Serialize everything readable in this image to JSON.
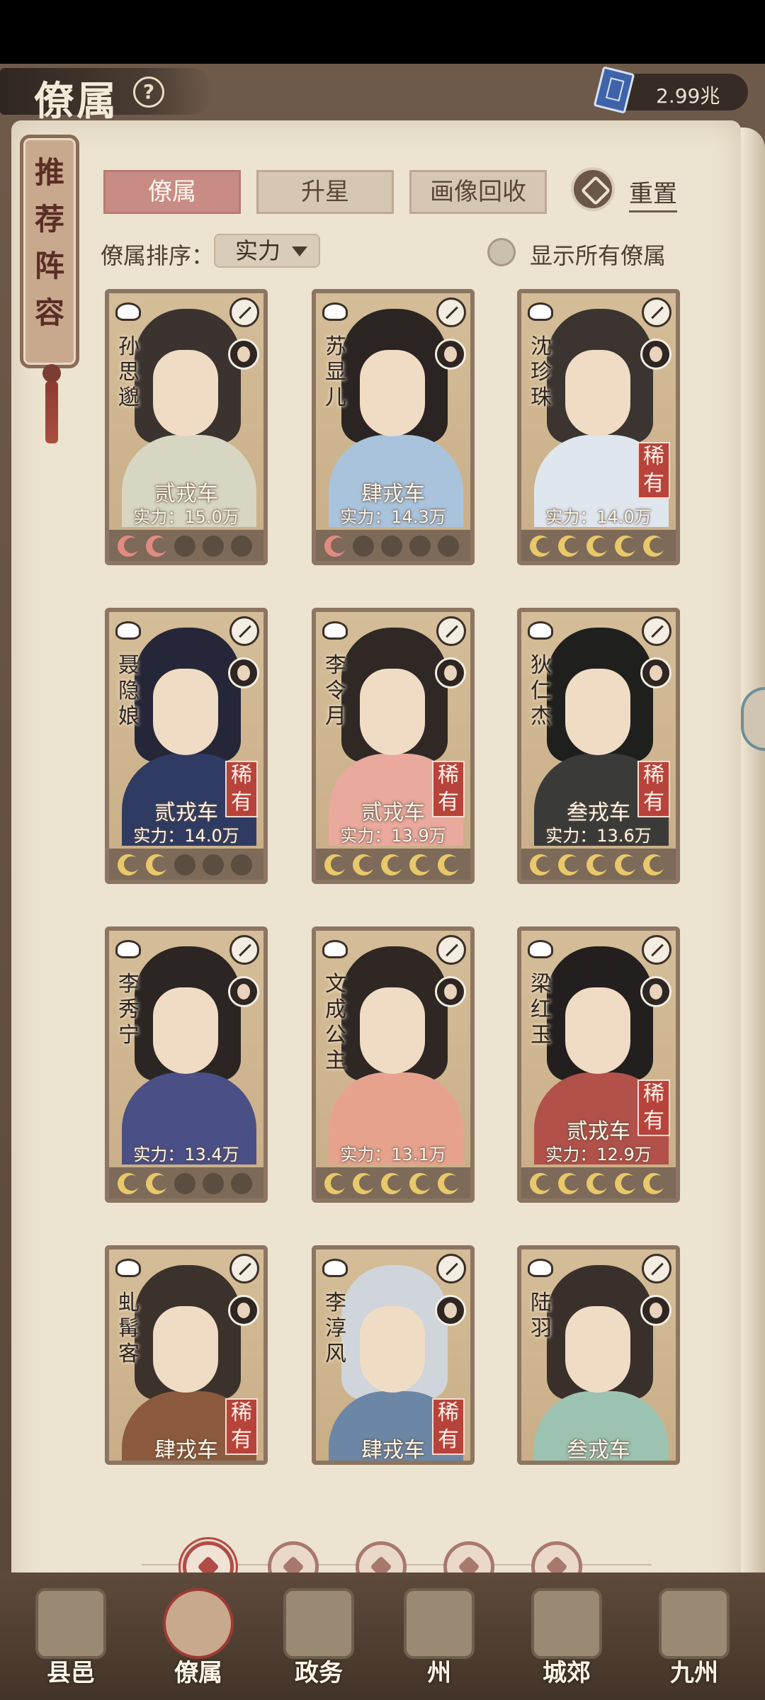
{
  "header": {
    "title": "僚属",
    "help_icon": "question-circle-icon",
    "currency": {
      "icon": "blue-book-icon",
      "value": "2.99兆"
    }
  },
  "side_plaque": {
    "text": [
      "推",
      "荐",
      "阵",
      "容"
    ]
  },
  "tabs": [
    {
      "label": "僚属",
      "active": true
    },
    {
      "label": "升星",
      "active": false
    },
    {
      "label": "画像回收",
      "active": false
    }
  ],
  "reset": {
    "icon": "reset-icon",
    "label": "重置"
  },
  "sort": {
    "label": "僚属排序：",
    "selected": "实力"
  },
  "show_all": {
    "label": "显示所有僚属",
    "checked": false
  },
  "cards": [
    {
      "name": [
        "孙",
        "思",
        "邈"
      ],
      "level": "贰戎车",
      "power": "实力：15.0万",
      "rare": "",
      "stars": [
        "red",
        "red",
        "empty",
        "empty",
        "empty"
      ],
      "robe": "#d7d6c3",
      "hair": "#3a3330"
    },
    {
      "name": [
        "苏",
        "显",
        "儿"
      ],
      "level": "肆戎车",
      "power": "实力：14.3万",
      "rare": "",
      "stars": [
        "red",
        "empty",
        "empty",
        "empty",
        "empty"
      ],
      "robe": "#a9c3dc",
      "hair": "#2a2523"
    },
    {
      "name": [
        "沈",
        "珍",
        "珠"
      ],
      "level": "",
      "power": "实力：14.0万",
      "rare": "稀有",
      "stars": [
        "gold",
        "gold",
        "gold",
        "gold",
        "gold"
      ],
      "robe": "#dfe6ee",
      "hair": "#3b3430"
    },
    {
      "name": [
        "聂",
        "隐",
        "娘"
      ],
      "level": "贰戎车",
      "power": "实力：14.0万",
      "rare": "稀有",
      "stars": [
        "gold",
        "gold",
        "empty",
        "empty",
        "empty"
      ],
      "robe": "#2f3b63",
      "hair": "#252638"
    },
    {
      "name": [
        "李",
        "令",
        "月"
      ],
      "level": "贰戎车",
      "power": "实力：13.9万",
      "rare": "稀有",
      "stars": [
        "gold",
        "gold",
        "gold",
        "gold",
        "gold"
      ],
      "robe": "#e9a99c",
      "hair": "#2f2825"
    },
    {
      "name": [
        "狄",
        "仁",
        "杰"
      ],
      "level": "叁戎车",
      "power": "实力：13.6万",
      "rare": "稀有",
      "stars": [
        "gold",
        "gold",
        "gold",
        "gold",
        "gold"
      ],
      "robe": "#3a3b38",
      "hair": "#1f1f1e"
    },
    {
      "name": [
        "李",
        "秀",
        "宁"
      ],
      "level": "",
      "power": "实力：13.4万",
      "rare": "",
      "stars": [
        "gold",
        "gold",
        "empty",
        "empty",
        "empty"
      ],
      "robe": "#4a4f86",
      "hair": "#2b2624"
    },
    {
      "name": [
        "文",
        "成",
        "公",
        "主"
      ],
      "level": "",
      "power": "实力：13.1万",
      "rare": "",
      "stars": [
        "gold",
        "gold",
        "gold",
        "gold",
        "gold"
      ],
      "robe": "#e7a28e",
      "hair": "#2e2724"
    },
    {
      "name": [
        "梁",
        "红",
        "玉"
      ],
      "level": "贰戎车",
      "power": "实力：12.9万",
      "rare": "稀有",
      "stars": [
        "gold",
        "gold",
        "gold",
        "gold",
        "gold"
      ],
      "robe": "#b2514a",
      "hair": "#231f1e"
    },
    {
      "name": [
        "虬",
        "髯",
        "客"
      ],
      "level": "肆戎车",
      "power": "",
      "rare": "稀有",
      "stars": [],
      "robe": "#8c5a3e",
      "hair": "#3b322c"
    },
    {
      "name": [
        "李",
        "淳",
        "风"
      ],
      "level": "肆戎车",
      "power": "",
      "rare": "稀有",
      "stars": [],
      "robe": "#6c87a6",
      "hair": "#cfd5da"
    },
    {
      "name": [
        "陆",
        "羽"
      ],
      "level": "叁戎车",
      "power": "",
      "rare": "",
      "stars": [],
      "robe": "#9cc3b1",
      "hair": "#3a302b"
    }
  ],
  "class_filters": [
    {
      "icon": "all-classes-icon",
      "active": true
    },
    {
      "icon": "helmet-icon",
      "active": false
    },
    {
      "icon": "gourd-icon",
      "active": false
    },
    {
      "icon": "fan-icon",
      "active": false
    },
    {
      "icon": "beast-icon",
      "active": false
    }
  ],
  "bottom_nav": [
    {
      "label": "县邑",
      "icon": "county-gate-icon",
      "active": false
    },
    {
      "label": "僚属",
      "icon": "officials-icon",
      "active": true
    },
    {
      "label": "政务",
      "icon": "documents-icon",
      "active": false
    },
    {
      "label": "州",
      "icon": "mountain-city-icon",
      "active": false
    },
    {
      "label": "城郊",
      "icon": "suburb-icon",
      "active": false
    },
    {
      "label": "九州",
      "icon": "scroll-map-icon",
      "active": false
    }
  ]
}
